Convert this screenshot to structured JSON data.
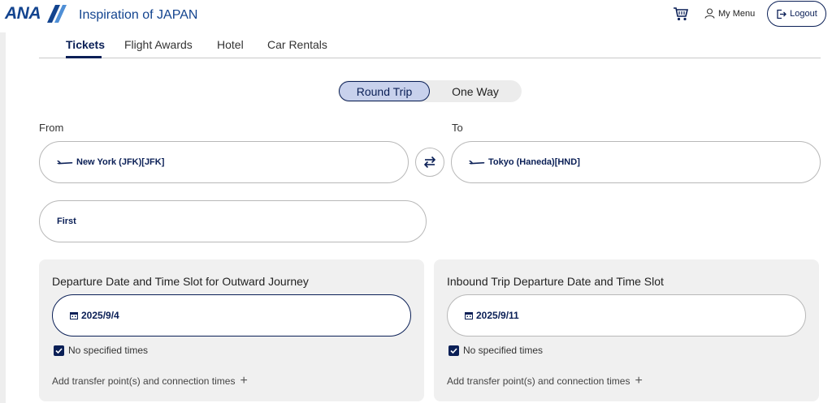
{
  "header": {
    "logo_text": "ANA",
    "tagline": "Inspiration of JAPAN",
    "cart_icon": "cart-icon",
    "my_menu_label": "My Menu",
    "logout_label": "Logout"
  },
  "tabs": [
    {
      "label": "Tickets",
      "active": true
    },
    {
      "label": "Flight Awards",
      "active": false
    },
    {
      "label": "Hotel",
      "active": false
    },
    {
      "label": "Car Rentals",
      "active": false
    }
  ],
  "trip_type": {
    "options": [
      "Round Trip",
      "One Way"
    ],
    "selected": "Round Trip"
  },
  "route": {
    "from_label": "From",
    "from_value": "New York (JFK)[JFK]",
    "to_label": "To",
    "to_value": "Tokyo (Haneda)[HND]"
  },
  "cabin": {
    "value": "First"
  },
  "outward": {
    "title": "Departure Date and Time Slot for Outward Journey",
    "date": "2025/9/4",
    "no_times_label": "No specified times",
    "no_times_checked": true,
    "add_transfer_label": "Add transfer point(s) and connection times"
  },
  "inbound": {
    "title": "Inbound Trip Departure Date and Time Slot",
    "date": "2025/9/11",
    "no_times_label": "No specified times",
    "no_times_checked": true,
    "add_transfer_label": "Add transfer point(s) and connection times"
  },
  "colors": {
    "brand_navy": "#0a1f56",
    "logo_blue": "#13448f",
    "toggle_active_bg": "#c8d1ec",
    "panel_bg": "#f0f0f0"
  }
}
